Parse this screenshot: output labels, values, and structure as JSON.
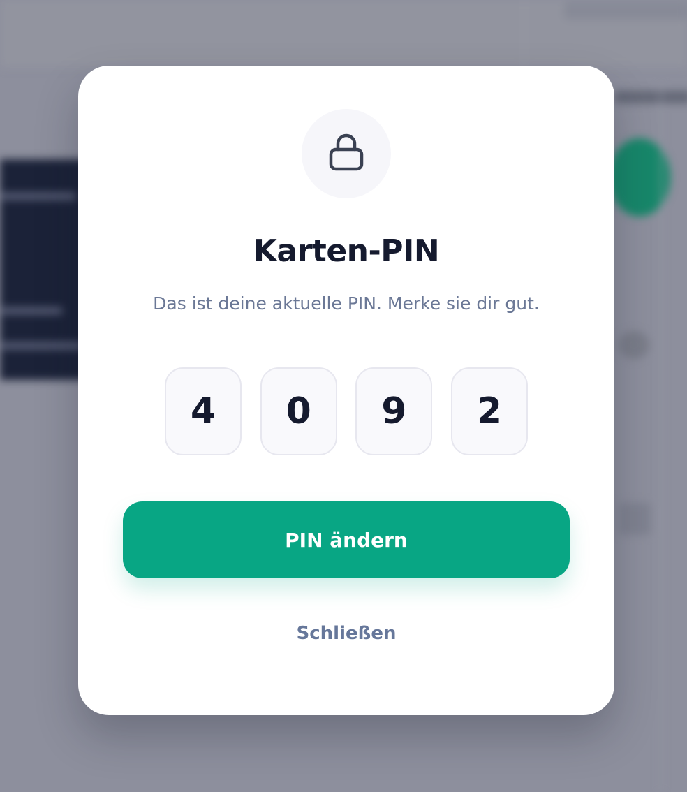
{
  "dialog": {
    "title": "Karten-PIN",
    "subtitle": "Das ist deine aktuelle PIN. Merke sie dir gut.",
    "lock_icon": "lock-icon",
    "pin_digits": [
      "4",
      "0",
      "9",
      "2"
    ],
    "primary_label": "PIN ändern",
    "close_label": "Schließen"
  },
  "colors": {
    "accent": "#08a684",
    "title": "#151a2e",
    "muted": "#6b7896",
    "backdrop": "#8d8f9d"
  }
}
